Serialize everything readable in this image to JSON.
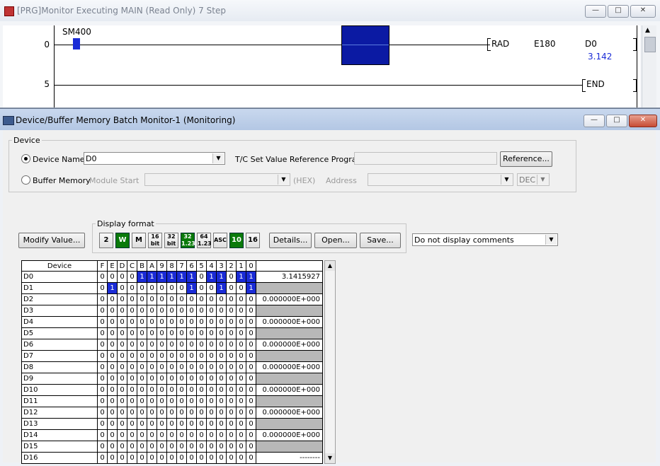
{
  "prg_window": {
    "title": "[PRG]Monitor Executing MAIN (Read Only) 7 Step",
    "rungs": [
      {
        "step": "0",
        "contact": "SM400",
        "instruction": "RAD",
        "arg1": "E180",
        "arg2": "D0",
        "arg2_value": "3.142"
      },
      {
        "step": "5",
        "instruction": "END"
      }
    ]
  },
  "monitor_window": {
    "title": "Device/Buffer Memory Batch Monitor-1 (Monitoring)",
    "device_group": "Device",
    "device_name_label": "Device Name",
    "device_name_value": "D0",
    "tc_label": "T/C Set Value Reference Program",
    "reference_button": "Reference...",
    "buffer_memory_label": "Buffer Memory",
    "module_start_label": "Module Start",
    "hex_label": "(HEX)",
    "address_label": "Address",
    "dec_value": "DEC",
    "modify_button": "Modify Value...",
    "display_format_label": "Display format",
    "format_buttons": [
      "2",
      "W",
      "DW",
      "16 bit",
      "32 bit",
      "32 1.23",
      "64 1.23",
      "ASC",
      "10",
      "16"
    ],
    "details_button": "Details...",
    "open_button": "Open...",
    "save_button": "Save...",
    "comment_select": "Do not display comments",
    "table": {
      "col_device": "Device",
      "bit_headers": [
        "F",
        "E",
        "D",
        "C",
        "B",
        "A",
        "9",
        "8",
        "7",
        "6",
        "5",
        "4",
        "3",
        "2",
        "1",
        "0"
      ],
      "rows": [
        {
          "device": "D0",
          "bits": "0000111111011011",
          "value": "3.1415927"
        },
        {
          "device": "D1",
          "bits": "0100000001001001",
          "value": ""
        },
        {
          "device": "D2",
          "bits": "0000000000000000",
          "value": "0.000000E+000"
        },
        {
          "device": "D3",
          "bits": "0000000000000000",
          "value": ""
        },
        {
          "device": "D4",
          "bits": "0000000000000000",
          "value": "0.000000E+000"
        },
        {
          "device": "D5",
          "bits": "0000000000000000",
          "value": ""
        },
        {
          "device": "D6",
          "bits": "0000000000000000",
          "value": "0.000000E+000"
        },
        {
          "device": "D7",
          "bits": "0000000000000000",
          "value": ""
        },
        {
          "device": "D8",
          "bits": "0000000000000000",
          "value": "0.000000E+000"
        },
        {
          "device": "D9",
          "bits": "0000000000000000",
          "value": ""
        },
        {
          "device": "D10",
          "bits": "0000000000000000",
          "value": "0.000000E+000"
        },
        {
          "device": "D11",
          "bits": "0000000000000000",
          "value": ""
        },
        {
          "device": "D12",
          "bits": "0000000000000000",
          "value": "0.000000E+000"
        },
        {
          "device": "D13",
          "bits": "0000000000000000",
          "value": ""
        },
        {
          "device": "D14",
          "bits": "0000000000000000",
          "value": "0.000000E+000"
        },
        {
          "device": "D15",
          "bits": "0000000000000000",
          "value": ""
        },
        {
          "device": "D16",
          "bits": "0000000000000000",
          "value": "--------"
        }
      ]
    }
  }
}
